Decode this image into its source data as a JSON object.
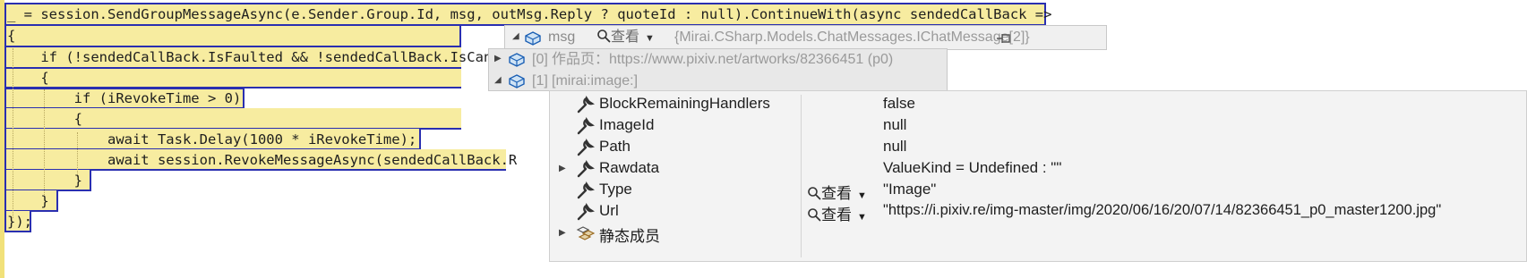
{
  "code": {
    "lines": [
      "_ = session.SendGroupMessageAsync(e.Sender.Group.Id, msg, outMsg.Reply ? quoteId : null).ContinueWith(async sendedCallBack =>",
      "{",
      "    if (!sendedCallBack.IsFaulted && !sendedCallBack.IsCan",
      "    {",
      "        if (iRevokeTime > 0)",
      "        {",
      "            await Task.Delay(1000 * iRevokeTime);",
      "            await session.RevokeMessageAsync(sendedCallBack.R",
      "        }",
      "    }",
      "});"
    ]
  },
  "datatip": {
    "variable": "msg",
    "view_label": "查看",
    "type_value": "{Mirai.CSharp.Models.ChatMessages.IChatMessage[2]}",
    "items": [
      {
        "index": "[0]",
        "value": "作品页：https://www.pixiv.net/artworks/82366451 (p0)"
      },
      {
        "index": "[1]",
        "value": "[mirai:image:]"
      }
    ]
  },
  "properties": {
    "rows": [
      {
        "name": "BlockRemainingHandlers",
        "value": "false",
        "has_view": false
      },
      {
        "name": "ImageId",
        "value": "null",
        "has_view": false
      },
      {
        "name": "Path",
        "value": "null",
        "has_view": false
      },
      {
        "name": "Rawdata",
        "value": "ValueKind = Undefined : \"\"",
        "has_view": false,
        "expandable": true
      },
      {
        "name": "Type",
        "value": "\"Image\"",
        "has_view": true
      },
      {
        "name": "Url",
        "value": "\"https://i.pixiv.re/img-master/img/2020/06/16/20/07/14/82366451_p0_master1200.jpg\"",
        "has_view": true
      }
    ],
    "static_members": "静态成员",
    "view_label": "查看"
  }
}
